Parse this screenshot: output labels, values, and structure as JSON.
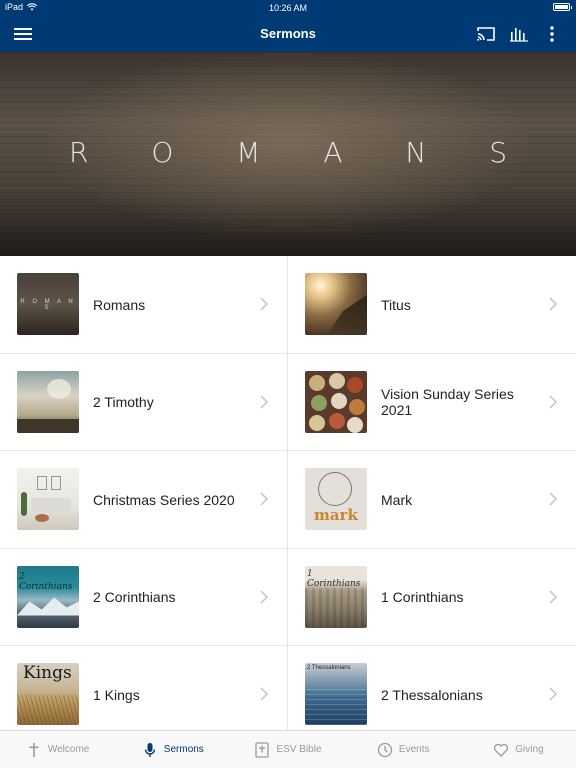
{
  "status": {
    "device": "iPad",
    "time": "10:26 AM"
  },
  "header": {
    "title": "Sermons"
  },
  "hero": {
    "title": "R O M A N S"
  },
  "series": [
    {
      "label": "Romans",
      "thumb_text": "R O M A N S"
    },
    {
      "label": "Titus"
    },
    {
      "label": "2 Timothy"
    },
    {
      "label": "Vision Sunday Series 2021"
    },
    {
      "label": "Christmas Series 2020"
    },
    {
      "label": "Mark",
      "thumb_text": "mark"
    },
    {
      "label": "2 Corinthians",
      "thumb_text": "2 Corinthians"
    },
    {
      "label": "1 Corinthians",
      "thumb_text": "1 Corinthians"
    },
    {
      "label": "1 Kings",
      "thumb_text": "Kings"
    },
    {
      "label": "2 Thessalonians",
      "thumb_text": "2 Thessalonians"
    }
  ],
  "tabs": [
    {
      "label": "Welcome",
      "icon": "cross-icon"
    },
    {
      "label": "Sermons",
      "icon": "microphone-icon"
    },
    {
      "label": "ESV Bible",
      "icon": "bible-icon"
    },
    {
      "label": "Events",
      "icon": "clock-icon"
    },
    {
      "label": "Giving",
      "icon": "heart-icon"
    }
  ],
  "colors": {
    "brand": "#003a74",
    "tab_inactive": "#9a9a9a"
  }
}
